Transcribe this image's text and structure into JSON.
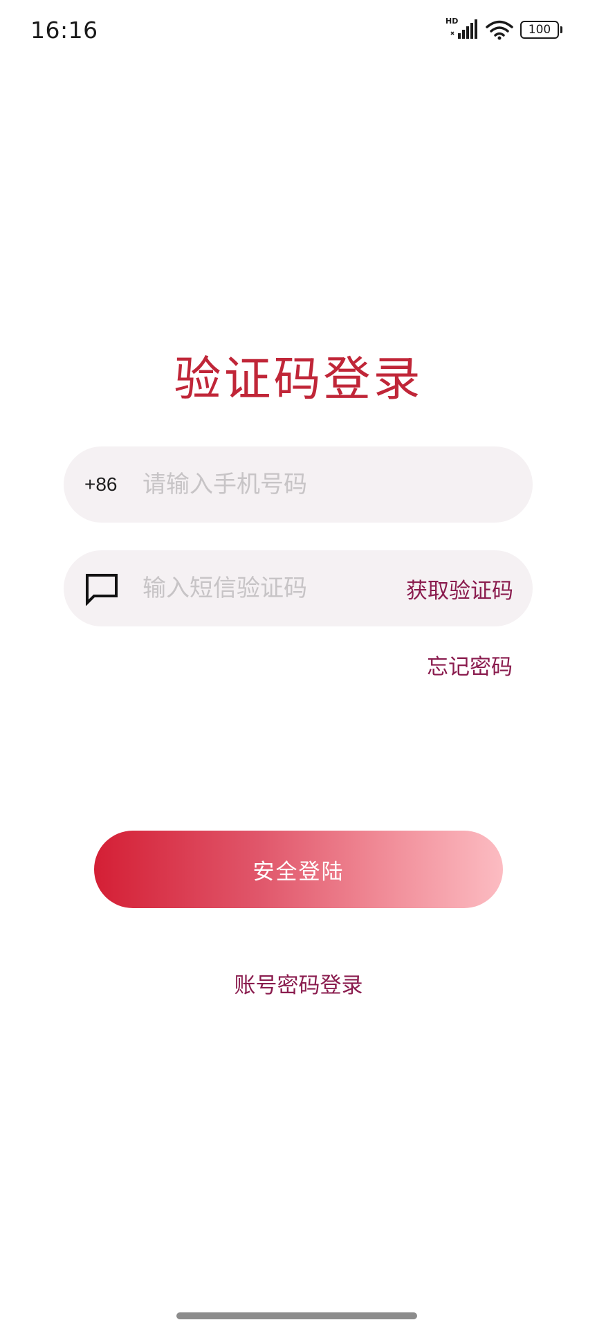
{
  "status_bar": {
    "time": "16:16",
    "hd": "HD",
    "battery": "100",
    "icons": [
      "signal-icon",
      "wifi-icon",
      "battery-icon"
    ]
  },
  "title": "验证码登录",
  "phone_field": {
    "country_code": "+86",
    "placeholder": "请输入手机号码",
    "value": ""
  },
  "code_field": {
    "icon": "message-icon",
    "placeholder": "输入短信验证码",
    "value": "",
    "get_code_label": "获取验证码"
  },
  "forgot_password": "忘记密码",
  "login_button": "安全登陆",
  "account_login": "账号密码登录",
  "colors": {
    "title": "#c02638",
    "link": "#8a1c4e",
    "field_bg": "#f5f1f3",
    "button_start": "#d41f35",
    "button_end": "#fcbcc2"
  }
}
